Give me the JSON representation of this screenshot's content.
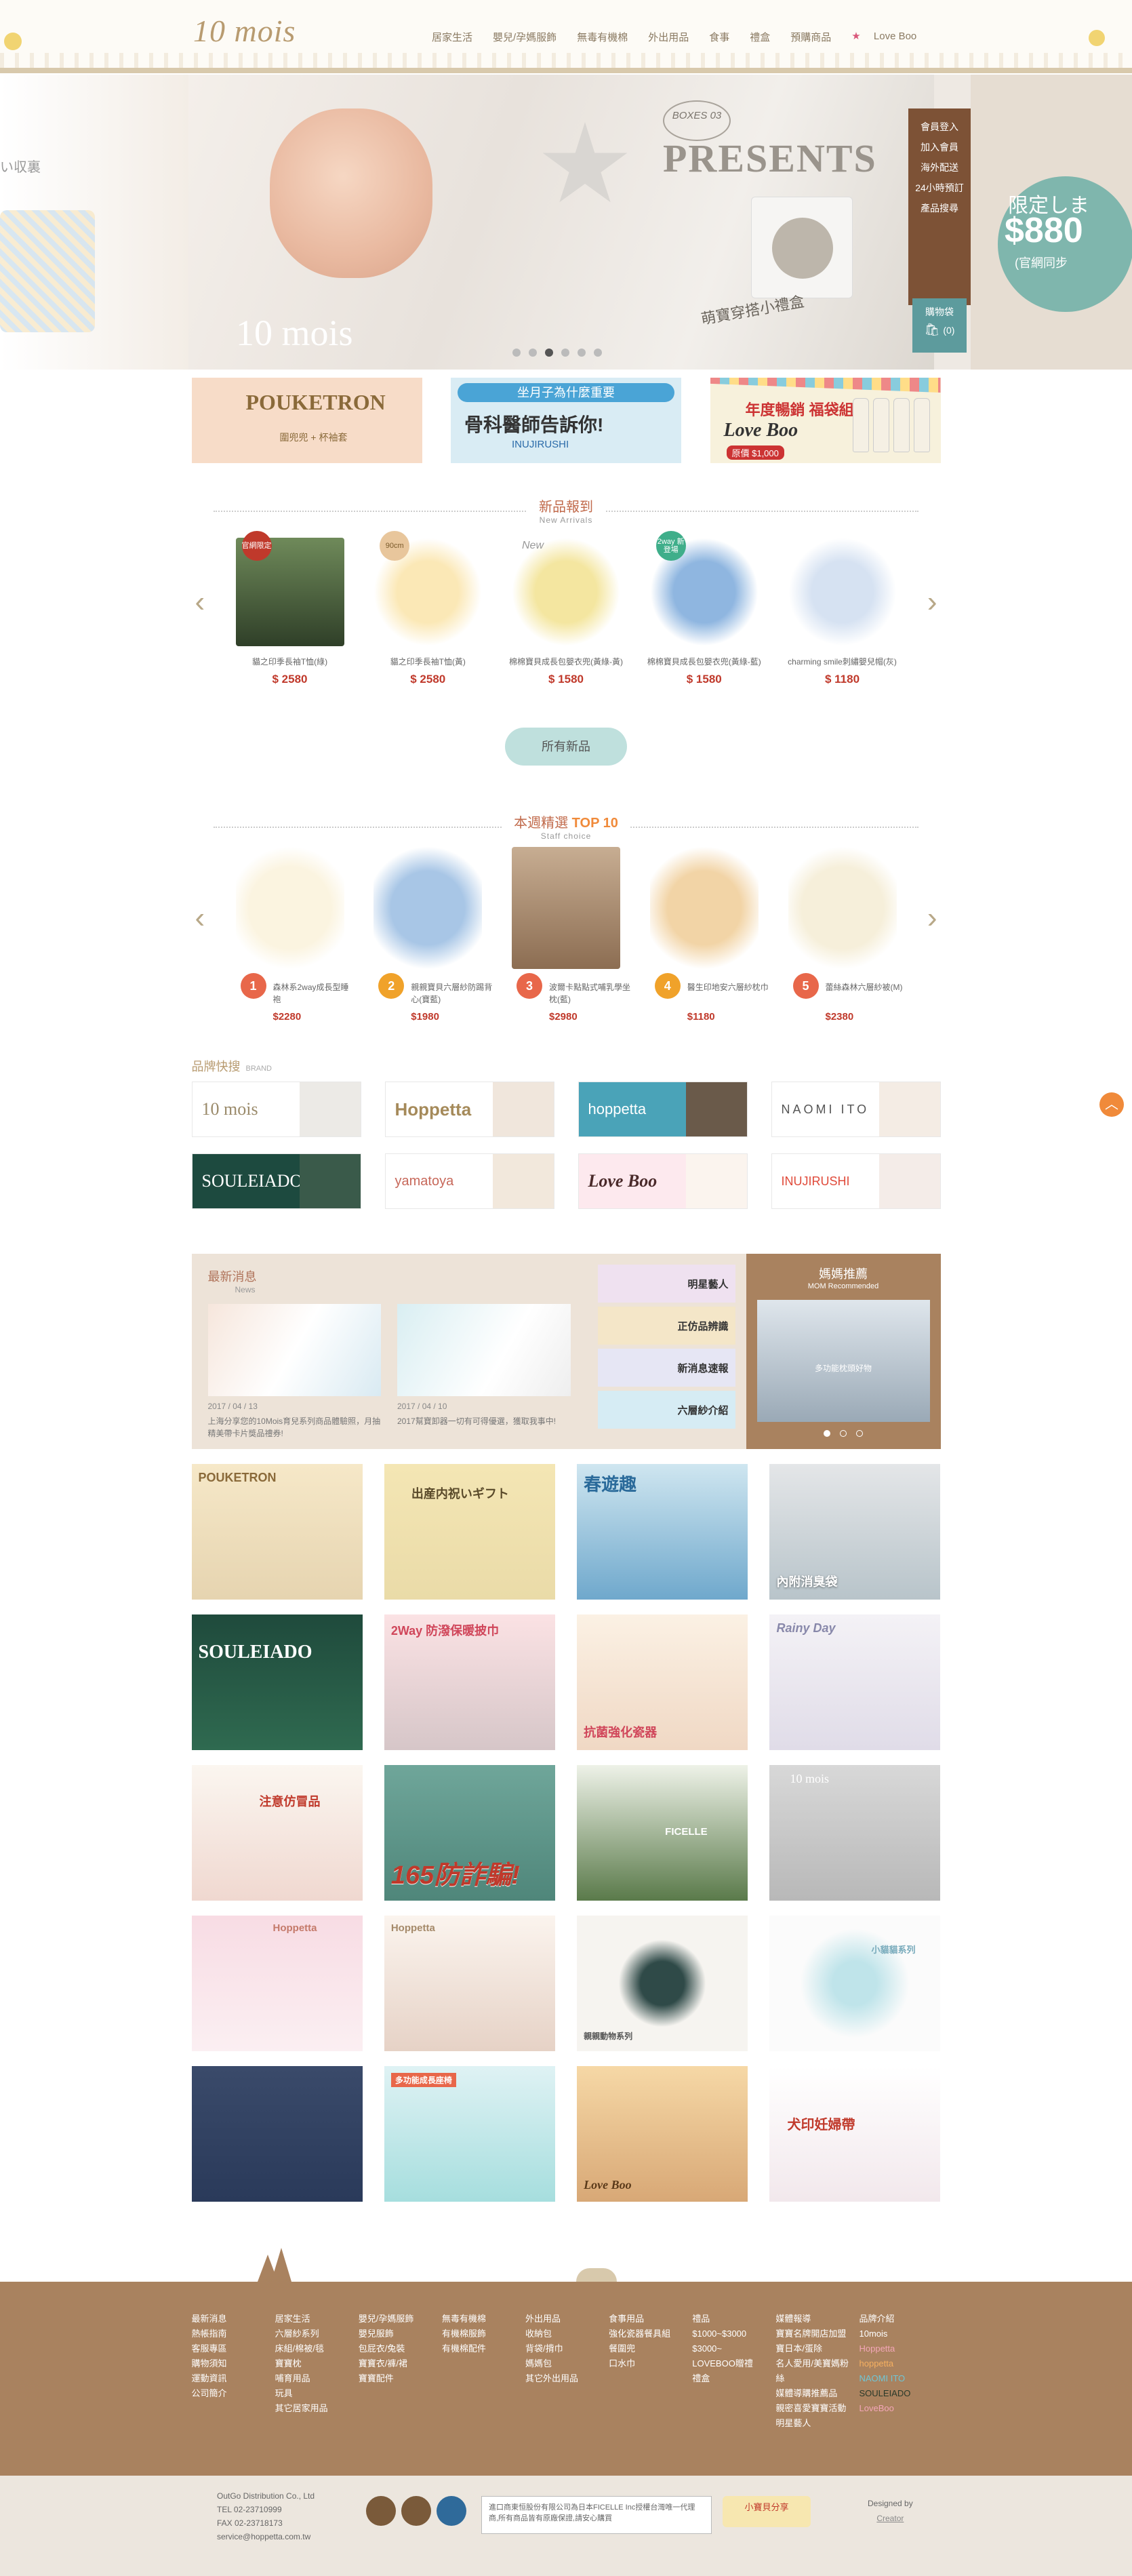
{
  "header": {
    "logo": "10 mois",
    "nav": [
      "居家生活",
      "嬰兒/孕媽服飾",
      "無毒有機棉",
      "外出用品",
      "食事",
      "禮盒",
      "預購商品"
    ],
    "love_boo": "Love Boo"
  },
  "hero": {
    "left_text": "い収裏",
    "boxes": "BOXES 03",
    "presents": "PRESENTS",
    "caption": "萌寶穿搭小禮盒",
    "logo": "10 mois",
    "side_menu": [
      "會員登入",
      "加入會員",
      "海外配送",
      "24小時預訂",
      "產品搜尋"
    ],
    "cart_label": "購物袋",
    "cart_count": "(0)",
    "limited": "限定しま",
    "price": "$880",
    "official": "(官網同步"
  },
  "promos": {
    "p1_title": "POUKETRON",
    "p1_sub": "圍兜兜   +   杯袖套",
    "p2_head": "坐月子為什麼重要",
    "p2_title": "骨科醫師告訴你!",
    "p2_brand": "INUJIRUSHI",
    "p3_title": "年度暢銷 福袋組",
    "p3_brand": "Love Boo",
    "p3_price": "原價 $1,000"
  },
  "new_arrivals": {
    "title": "新品報到",
    "subtitle": "New Arrivals",
    "items": [
      {
        "badge": "官網限定",
        "name": "貓之印季長袖T恤(綠)",
        "price": "$ 2580"
      },
      {
        "badge": "90cm",
        "name": "貓之印季長袖T恤(黃)",
        "price": "$ 2580"
      },
      {
        "badge": "New",
        "name": "棉棉寶貝成長包嬰衣兜(黃綠-黃)",
        "price": "$ 1580"
      },
      {
        "badge": "2way 新登場",
        "name": "棉棉寶貝成長包嬰衣兜(黃綠-藍)",
        "price": "$ 1580"
      },
      {
        "badge": "",
        "name": "charming smile刺繡嬰兒帽(灰)",
        "price": "$ 1180"
      }
    ],
    "all_button": "所有新品"
  },
  "top10": {
    "title": "本週精選",
    "subtitle": "Staff choice",
    "badge": "TOP 10",
    "items": [
      {
        "rank": "1",
        "name": "森林系2way成長型睡袍",
        "price": "$2280"
      },
      {
        "rank": "2",
        "name": "親親寶貝六層紗防踢背心(寶藍)",
        "price": "$1980"
      },
      {
        "rank": "3",
        "name": "波爾卡點點式哺乳學坐枕(藍)",
        "price": "$2980"
      },
      {
        "rank": "4",
        "name": "醫生印地安六層紗枕巾",
        "price": "$1180"
      },
      {
        "rank": "5",
        "name": "蕾絲森林六層紗被(M)",
        "price": "$2380"
      }
    ]
  },
  "brands": {
    "title": "品牌快搜",
    "subtitle": "BRAND",
    "items": [
      "10 mois",
      "Hoppetta",
      "hoppetta",
      "NAOMI ITO",
      "SOULEIADO",
      "yamatoya",
      "Love Boo",
      "INUJIRUSHI"
    ]
  },
  "news": {
    "title": "最新消息",
    "subtitle": "News",
    "cards": [
      {
        "date": "2017 / 04 / 13",
        "text": "上海分享您的10Mois育兒系列商品體驗照，月抽精美帶卡片獎品禮券!"
      },
      {
        "date": "2017 / 04 / 10",
        "text": "2017幫寶卸器一切有可得優選，獲取我事中!"
      }
    ],
    "buttons": [
      "明星藝人",
      "正仿品辨識",
      "新消息速報",
      "六層紗介紹"
    ]
  },
  "mom": {
    "title": "媽媽推薦",
    "subtitle": "MOM Recommended",
    "caption": "多功能枕頭好物"
  },
  "tiles": [
    "POUKETRON",
    "出産内祝いギフト",
    "春遊趣",
    "內附消臭袋",
    "SOULEIADO",
    "2Way 防潑保暖披巾",
    "抗菌強化瓷器",
    "Rainy Day",
    "注意仿冒品",
    "165防詐騙!",
    "FICELLE",
    "10 mois",
    "Hoppetta",
    "Hoppetta",
    "親親動物系列",
    "小貓貓系列",
    "",
    "多功能成長座椅",
    "Love Boo",
    "犬印妊婦帶"
  ],
  "footer": {
    "cols": [
      [
        "最新消息",
        "熱帳指南",
        "客服專區",
        "購物須知",
        "運動資訊",
        "公司簡介"
      ],
      [
        "居家生活",
        "六層紗系列",
        "床組/棉被/毯",
        "寶寶枕",
        "哺育用品",
        "玩具",
        "其它居家用品"
      ],
      [
        "嬰兒/孕媽服飾",
        "嬰兒服飾",
        "包屁衣/兔裝",
        "寶寶衣/褲/裙",
        "寶寶配件"
      ],
      [
        "無毒有機棉",
        "有機棉服飾",
        "有機棉配件"
      ],
      [
        "外出用品",
        "收納包",
        "背袋/揹巾",
        "媽媽包",
        "其它外出用品"
      ],
      [
        "食事用品",
        "強化瓷器餐具組",
        "餐圍兜",
        "口水巾"
      ],
      [
        "禮品",
        "$1000~$3000",
        "$3000~",
        "LOVEBOO贈禮",
        "禮盒"
      ],
      [
        "媒體報導",
        "寶寶名牌開店加盟",
        "寶日本/蛋除",
        "名人愛用/美寶媽粉絲",
        "媒體導購推薦品",
        "親密喜愛寶寶活動",
        "明星藝人"
      ],
      [
        "品牌介紹",
        "10mois",
        "Hoppetta",
        "hoppetta",
        "NAOMI ITO",
        "SOULEIADO",
        "LoveBoo"
      ]
    ],
    "company": "OutGo Distribution Co., Ltd",
    "tel": "TEL 02-23710999",
    "fax": "FAX 02-23718173",
    "email": "service@hoppetta.com.tw",
    "notice": "進口商東恒股份有限公司為日本FICELLE Inc授權台灣唯一代理商,所有商品皆有原廠保證,請安心購買",
    "share": "小寶貝分享",
    "designed": "Designed by",
    "designer": "Creator"
  }
}
